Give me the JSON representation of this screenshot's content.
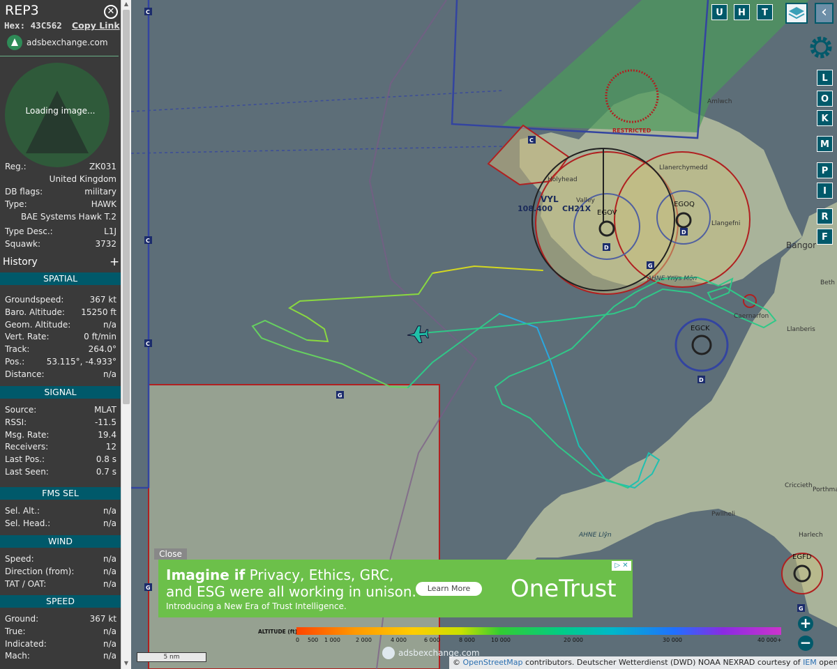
{
  "aircraft": {
    "callsign": "REP3",
    "hex_label": "Hex:",
    "hex": "43C562",
    "copy_link": "Copy Link",
    "site_link": "adsbexchange.com",
    "photo_loading": "Loading image..."
  },
  "details": [
    {
      "label": "Reg.:",
      "value": "ZK031"
    },
    {
      "label": "",
      "value": "United Kingdom"
    },
    {
      "label": "DB flags:",
      "value": "military"
    },
    {
      "label": "Type:",
      "value": "HAWK"
    },
    {
      "label": "",
      "value": "BAE Systems Hawk T.2"
    },
    {
      "label": "Type Desc.:",
      "value": "L1J"
    },
    {
      "label": "Squawk:",
      "value": "3732"
    }
  ],
  "history_label": "History",
  "history_plus": "+",
  "sections": {
    "spatial": {
      "title": "SPATIAL",
      "rows": [
        {
          "label": "Groundspeed:",
          "value": "367 kt"
        },
        {
          "label": "Baro. Altitude:",
          "value": "15250 ft"
        },
        {
          "label": "Geom. Altitude:",
          "value": "n/a"
        },
        {
          "label": "Vert. Rate:",
          "value": "0 ft/min"
        },
        {
          "label": "Track:",
          "value": "264.0°"
        },
        {
          "label": "Pos.:",
          "value": "53.115°, -4.933°"
        },
        {
          "label": "Distance:",
          "value": "n/a"
        }
      ]
    },
    "signal": {
      "title": "SIGNAL",
      "rows": [
        {
          "label": "Source:",
          "value": "MLAT"
        },
        {
          "label": "RSSI:",
          "value": "-11.5"
        },
        {
          "label": "Msg. Rate:",
          "value": "19.4"
        },
        {
          "label": "Receivers:",
          "value": "12"
        },
        {
          "label": "Last Pos.:",
          "value": "0.8 s"
        },
        {
          "label": "Last Seen:",
          "value": "0.7 s"
        }
      ]
    },
    "fms": {
      "title": "FMS SEL",
      "rows": [
        {
          "label": "Sel. Alt.:",
          "value": "n/a"
        },
        {
          "label": "Sel. Head.:",
          "value": "n/a"
        }
      ]
    },
    "wind": {
      "title": "WIND",
      "rows": [
        {
          "label": "Speed:",
          "value": "n/a"
        },
        {
          "label": "Direction (from):",
          "value": "n/a"
        },
        {
          "label": "TAT / OAT:",
          "value": "n/a"
        }
      ]
    },
    "speed": {
      "title": "SPEED",
      "rows": [
        {
          "label": "Ground:",
          "value": "367 kt"
        },
        {
          "label": "True:",
          "value": "n/a"
        },
        {
          "label": "Indicated:",
          "value": "n/a"
        },
        {
          "label": "Mach:",
          "value": "n/a"
        }
      ]
    }
  },
  "toolbar": {
    "top_buttons": [
      "U",
      "H",
      "T"
    ],
    "side_buttons": [
      "L",
      "O",
      "K",
      "M",
      "P",
      "I",
      "R",
      "F"
    ],
    "zoom_in": "+",
    "zoom_out": "−",
    "back": "‹"
  },
  "map_labels": {
    "restricted": "RESTRICTED",
    "vor_name": "VYL",
    "vor_freq": "108.400",
    "vor_channel": "CH21X",
    "airfields": [
      "EGOV",
      "EGOQ",
      "EGCK",
      "EGFD"
    ],
    "towns": [
      "Amlwch",
      "Llanerchymedd",
      "Holyhead",
      "Valley",
      "Llangefni",
      "Bangor",
      "Caernarfon",
      "Llanberis",
      "Criccieth",
      "Porthmadog",
      "Pwllheli",
      "Harlech",
      "AHNE Llŷn",
      "AHNE Ynys Môn",
      "Beth"
    ],
    "marker_letters": {
      "c": "C",
      "g": "G",
      "d": "D"
    }
  },
  "ad": {
    "close": "Close",
    "headline_bold": "Imagine if",
    "headline_rest": " Privacy, Ethics, GRC,",
    "headline_line2": "and ESG were all working in unison.",
    "subline": "Introducing a New Era of Trust Intelligence.",
    "cta": "Learn More",
    "brand": "OneTrust",
    "adchoice": "▷ ✕"
  },
  "altitude_legend": {
    "label": "ALTITUDE (ft)",
    "ticks": [
      "0",
      "500",
      "1 000",
      "2 000",
      "4 000",
      "6 000",
      "8 000",
      "10 000",
      "20 000",
      "30 000",
      "40 000+"
    ]
  },
  "scale_bar": "5 nm",
  "watermark": "adsbexchange.com",
  "attribution": {
    "prefix": "© ",
    "osm": "OpenStreetMap",
    "mid": " contributors. Deutscher Wetterdienst (DWD) NOAA NEXRAD courtesy of ",
    "iem": "IEM",
    "suffix": " openAIP.net"
  },
  "colors": {
    "accent": "#00596a",
    "sea": "#5d6e78",
    "land": "#a9b39a",
    "airspace_red": "#b02020",
    "airspace_blue": "#3344a0",
    "ad_green": "#6cc04a"
  }
}
